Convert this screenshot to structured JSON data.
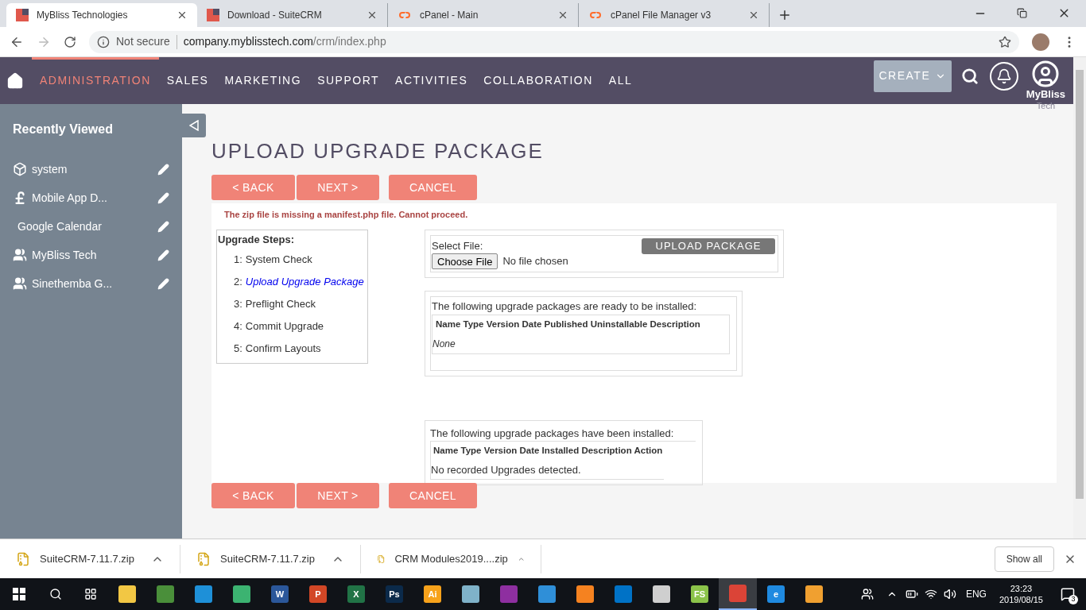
{
  "browser_tabs": [
    {
      "title": "MyBliss Technologies",
      "kind": "suite",
      "selected": true
    },
    {
      "title": "Download - SuiteCRM",
      "kind": "suite",
      "selected": false
    },
    {
      "title": "cPanel - Main",
      "kind": "cpanel",
      "selected": false
    },
    {
      "title": "cPanel File Manager v3",
      "kind": "cpanel",
      "selected": false
    }
  ],
  "address": {
    "security": "Not secure",
    "host": "company.myblisstech.com",
    "path": "/crm/index.php"
  },
  "nav": {
    "items": [
      {
        "label": "ADMINISTRATION",
        "selected": true
      },
      {
        "label": "SALES",
        "selected": false
      },
      {
        "label": "MARKETING",
        "selected": false
      },
      {
        "label": "SUPPORT",
        "selected": false
      },
      {
        "label": "ACTIVITIES",
        "selected": false
      },
      {
        "label": "COLLABORATION",
        "selected": false
      },
      {
        "label": "ALL",
        "selected": false
      }
    ],
    "create": "CREATE",
    "user_name": "MyBliss",
    "user_name_2": "Tech"
  },
  "sidebar": {
    "title": "Recently Viewed",
    "items": [
      {
        "label": "system",
        "kind": "box"
      },
      {
        "label": "Mobile App D...",
        "kind": "pound"
      },
      {
        "label": "Google Calendar",
        "kind": "none"
      },
      {
        "label": "MyBliss Tech",
        "kind": "people"
      },
      {
        "label": "Sinethemba G...",
        "kind": "people"
      }
    ]
  },
  "page": {
    "title": "UPLOAD UPGRADE PACKAGE",
    "buttons_top": [
      "< BACK",
      "NEXT >",
      "CANCEL"
    ],
    "error": "The zip file is missing a manifest.php file. Cannot proceed.",
    "steps": {
      "title": "Upgrade Steps:",
      "items": [
        {
          "number": "1:",
          "label": "System Check",
          "selected": false
        },
        {
          "number": "2:",
          "label": "Upload Upgrade Package",
          "selected": true
        },
        {
          "number": "3:",
          "label": "Preflight Check",
          "selected": false
        },
        {
          "number": "4:",
          "label": "Commit Upgrade",
          "selected": false
        },
        {
          "number": "5:",
          "label": "Confirm Layouts",
          "selected": false
        }
      ]
    },
    "upload": {
      "select_label": "Select File:",
      "choose_button": "Choose File",
      "no_file": "No file chosen",
      "upload_button": "UPLOAD PACKAGE"
    },
    "ready": {
      "caption": "The following upgrade packages are ready to be installed:",
      "header": "Name Type Version Date Published Uninstallable Description",
      "empty": "None"
    },
    "installed": {
      "caption": "The following upgrade packages have been installed:",
      "header": "Name Type Version Date Installed Description Action",
      "empty": "No recorded Upgrades detected."
    },
    "buttons_bottom": [
      "< BACK",
      "NEXT >",
      "CANCEL"
    ]
  },
  "downloads": {
    "items": [
      "SuiteCRM-7.11.7.zip",
      "SuiteCRM-7.11.7.zip",
      "CRM Modules2019....zip"
    ],
    "show_all": "Show all"
  },
  "taskbar": {
    "apps": [
      {
        "color": "#f2c744",
        "active": false
      },
      {
        "color": "#4a8f3a",
        "active": false
      },
      {
        "color": "#1e90d8",
        "active": false
      },
      {
        "color": "#3cb371",
        "active": false
      },
      {
        "color": "#2b579a",
        "label": "W",
        "active": false
      },
      {
        "color": "#d24726",
        "label": "P",
        "active": false
      },
      {
        "color": "#217346",
        "label": "X",
        "active": false
      },
      {
        "color": "#0b2a4a",
        "label": "Ps",
        "active": false
      },
      {
        "color": "#f7a21b",
        "label": "Ai",
        "active": false
      },
      {
        "color": "#7fb2c9",
        "active": false
      },
      {
        "color": "#8e2fa0",
        "active": false
      },
      {
        "color": "#2f8fd8",
        "active": false
      },
      {
        "color": "#f58220",
        "active": false
      },
      {
        "color": "#0072c6",
        "active": false
      },
      {
        "color": "#cfcfcf",
        "active": false
      },
      {
        "color": "#8bc34a",
        "label": "FS",
        "active": false
      },
      {
        "color": "#db4437",
        "active": true
      },
      {
        "color": "#1f8ae0",
        "label": "e",
        "active": false
      },
      {
        "color": "#f0a030",
        "active": false
      }
    ],
    "lang": "ENG",
    "time": "23:23",
    "date": "2019/08/15",
    "notifications": "3"
  }
}
